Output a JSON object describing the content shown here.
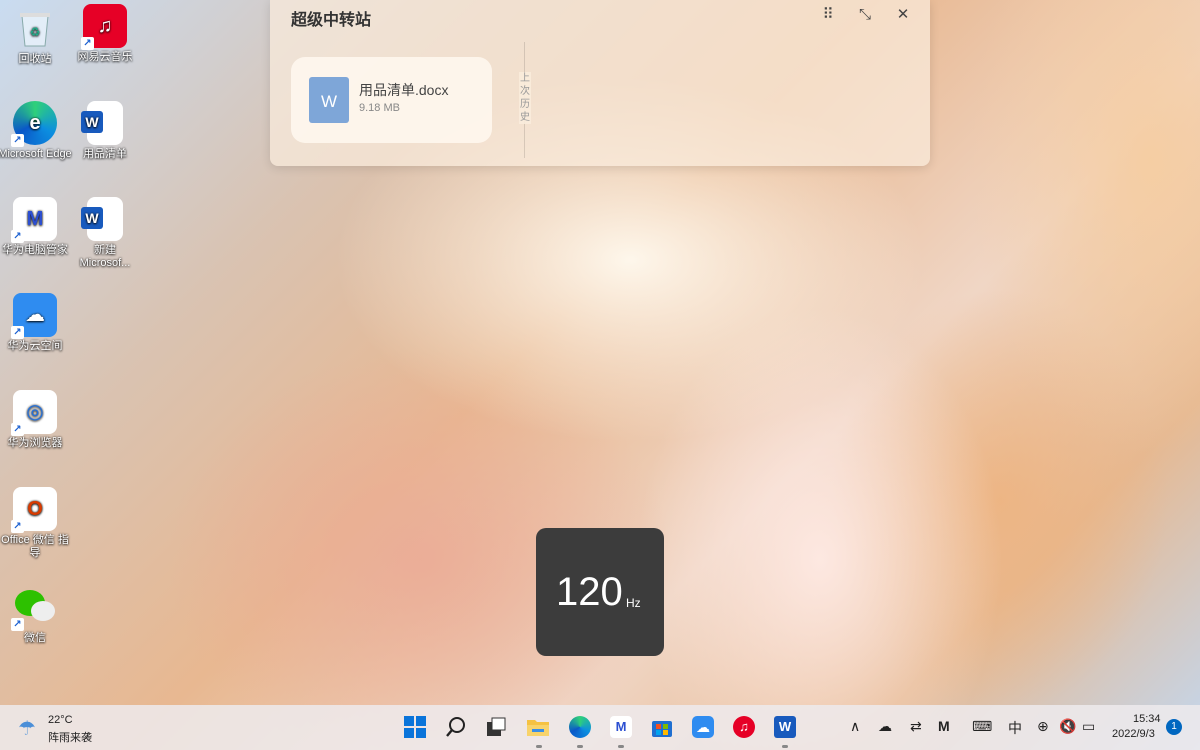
{
  "desktop": {
    "icons": [
      {
        "label": "回收站",
        "icon": "recycle-bin-icon"
      },
      {
        "label": "网易云音乐",
        "icon": "netease-music-icon"
      },
      {
        "label": "Microsoft Edge",
        "icon": "edge-icon"
      },
      {
        "label": "用品清单",
        "icon": "word-doc-icon"
      },
      {
        "label": "华为电脑管家",
        "icon": "huawei-pc-manager-icon"
      },
      {
        "label": "新建 Microsof...",
        "icon": "word-doc-icon"
      },
      {
        "label": "华为云空间",
        "icon": "huawei-cloud-icon"
      },
      {
        "label": "华为浏览器",
        "icon": "huawei-browser-icon"
      },
      {
        "label": "Office 微信 指导",
        "icon": "office-icon"
      },
      {
        "label": "微信",
        "icon": "wechat-icon"
      }
    ]
  },
  "transfer_station": {
    "title": "超级中转站",
    "file": {
      "name": "用品清单.docx",
      "size": "9.18 MB",
      "icon_letter": "W"
    },
    "history_label": "上次历史"
  },
  "refresh_rate": {
    "value": "120",
    "unit": "Hz"
  },
  "taskbar": {
    "weather": {
      "temp": "22°C",
      "desc": "阵雨来袭"
    },
    "apps": [
      "start",
      "search",
      "task-view",
      "file-explorer",
      "edge",
      "huawei-pc-manager",
      "store",
      "huawei-cloud",
      "netease-music",
      "word"
    ],
    "tray": {
      "ime": "中",
      "time": "15:34",
      "date": "2022/9/3",
      "notifications": "1"
    }
  },
  "colors": {
    "accent": "#0067c0",
    "word_blue": "#185abd",
    "netease_red": "#e60026"
  }
}
